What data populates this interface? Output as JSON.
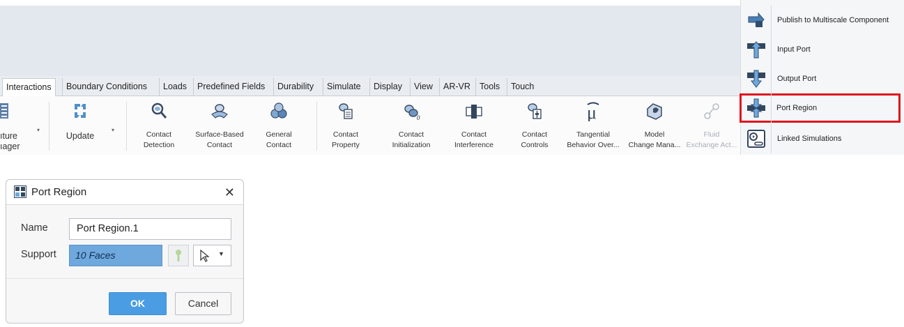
{
  "ribbon": {
    "tabs": [
      "Interactions",
      "Boundary Conditions",
      "Loads",
      "Predefined Fields",
      "Durability",
      "Simulate",
      "Display",
      "View",
      "AR-VR",
      "Tools",
      "Touch"
    ],
    "left_cmd": {
      "line1": "ıture",
      "line2": "ıager"
    },
    "update": {
      "label": "Update"
    },
    "commands": [
      {
        "line1": "Contact",
        "line2": "Detection"
      },
      {
        "line1": "Surface-Based",
        "line2": "Contact"
      },
      {
        "line1": "General",
        "line2": "Contact"
      },
      {
        "line1": "Contact",
        "line2": "Property"
      },
      {
        "line1": "Contact",
        "line2": "Initialization"
      },
      {
        "line1": "Contact",
        "line2": "Interference"
      },
      {
        "line1": "Contact",
        "line2": "Controls"
      },
      {
        "line1": "Tangential",
        "line2": "Behavior Over..."
      },
      {
        "line1": "Model",
        "line2": "Change Mana..."
      },
      {
        "line1": "Fluid",
        "line2": "Exchange Act..."
      }
    ]
  },
  "side_panel": {
    "items": [
      {
        "label": "Publish to Multiscale Component",
        "icon": "publish-multiscale-icon"
      },
      {
        "label": "Input Port",
        "icon": "input-port-icon"
      },
      {
        "label": "Output Port",
        "icon": "output-port-icon"
      },
      {
        "label": "Port Region",
        "icon": "port-region-icon"
      },
      {
        "label": "Linked Simulations",
        "icon": "linked-simulations-icon"
      }
    ],
    "highlight_color": "#e0141e"
  },
  "dialog": {
    "title": "Port Region",
    "close": "✕",
    "name_label": "Name",
    "name_value": "Port Region.1",
    "support_label": "Support",
    "support_value": "10 Faces",
    "ok": "OK",
    "cancel": "Cancel",
    "accent": "#4a9de2",
    "selection_color": "#6fa8dc"
  }
}
